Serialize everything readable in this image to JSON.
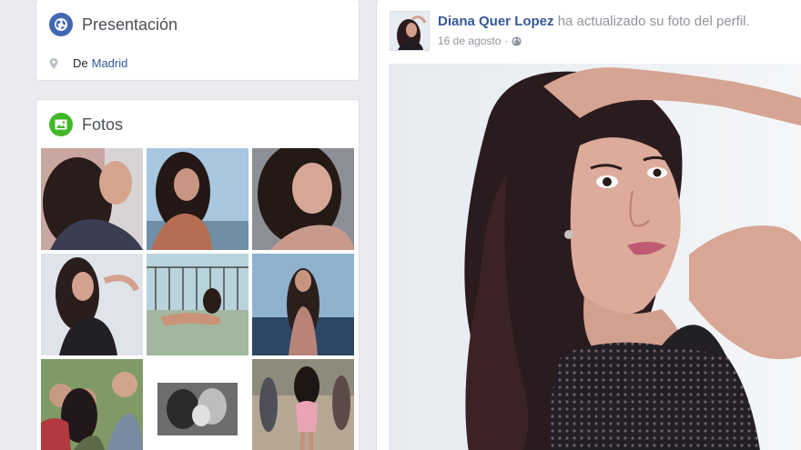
{
  "intro": {
    "title": "Presentación",
    "location_prefix": "De",
    "location_link": "Madrid",
    "icon": "globe-icon",
    "icon_color": "#4267b2"
  },
  "photos": {
    "title": "Fotos",
    "icon": "photo-icon",
    "icon_color": "#42b72a",
    "items": [
      {
        "name": "photo-1"
      },
      {
        "name": "photo-2"
      },
      {
        "name": "photo-3"
      },
      {
        "name": "photo-4"
      },
      {
        "name": "photo-5"
      },
      {
        "name": "photo-6"
      },
      {
        "name": "photo-7"
      },
      {
        "name": "photo-8"
      },
      {
        "name": "photo-9"
      }
    ]
  },
  "post": {
    "author": "Diana Quer Lopez",
    "action": "ha actualizado su foto del perfil.",
    "date": "16 de agosto",
    "separator": "·",
    "privacy_icon": "globe-icon",
    "link_color": "#365899"
  }
}
